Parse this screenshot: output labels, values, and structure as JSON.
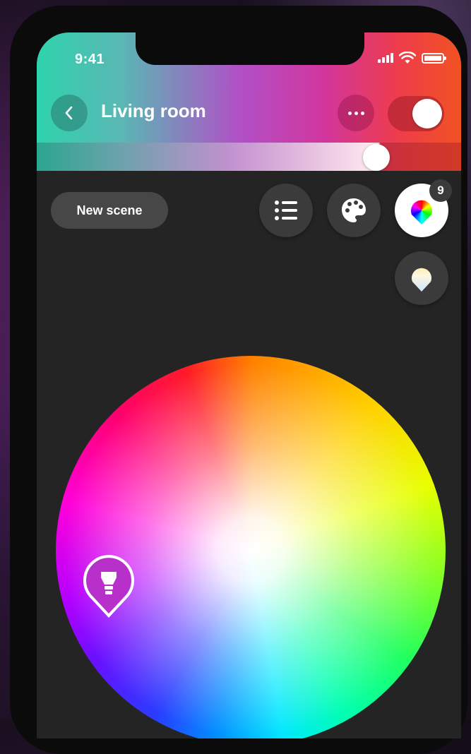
{
  "status_bar": {
    "time": "9:41"
  },
  "header": {
    "title": "Living room",
    "toggle_on": true,
    "brightness_fraction": 0.8,
    "gradient_colors": [
      "#2fd3ad",
      "#b24fc7",
      "#d2369c",
      "#f15222"
    ]
  },
  "toolbar": {
    "new_scene_label": "New scene",
    "color_badge_count": "9",
    "buttons": [
      "list-icon",
      "palette-icon",
      "color-drop-icon",
      "white-drop-icon"
    ]
  },
  "color_wheel": {
    "lights": [
      {
        "icon": "bulb-icon",
        "color": "#b630c9"
      }
    ]
  },
  "colors": {
    "background": "#242424",
    "button": "#3b3b3b",
    "new_scene_button": "#474747"
  }
}
